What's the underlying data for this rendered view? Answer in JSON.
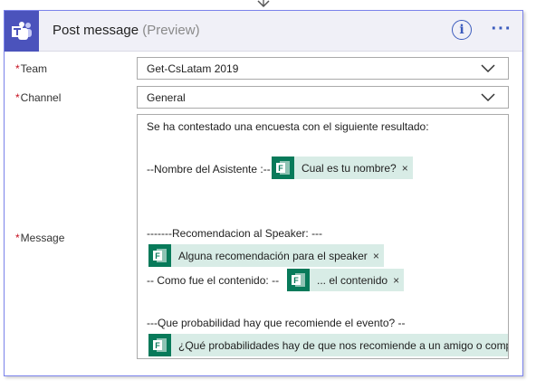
{
  "header": {
    "title": "Post message",
    "preview": "(Preview)",
    "info_icon": "info-icon",
    "more_icon": "more-options-icon",
    "more_glyph": "···",
    "info_glyph": "i",
    "app_icon": "microsoft-teams-icon",
    "accent_color": "#4b53bc"
  },
  "fields": {
    "required_marker": "*",
    "team": {
      "label": "Team",
      "value": "Get-CsLatam 2019"
    },
    "channel": {
      "label": "Channel",
      "value": "General"
    },
    "message": {
      "label": "Message"
    }
  },
  "message": {
    "line1": "Se ha contestado una encuesta con el siguiente resultado:",
    "line2_prefix": "--Nombre del Asistente :--",
    "token1": "Cual es tu nombre?",
    "line3": "-------Recomendacion al Speaker: ---",
    "token2": "Alguna recomendación para el speaker",
    "line4_prefix": "--  Como fue el contenido: --",
    "token3": "... el contenido",
    "line5": "---Que probabilidad hay que recomiende el evento? --",
    "token4": "¿Qué probabilidades hay de que nos recomiende a un amigo o compañero",
    "token_icon": "microsoft-forms-icon",
    "token_color": "#087a5a",
    "remove_glyph": "×"
  }
}
